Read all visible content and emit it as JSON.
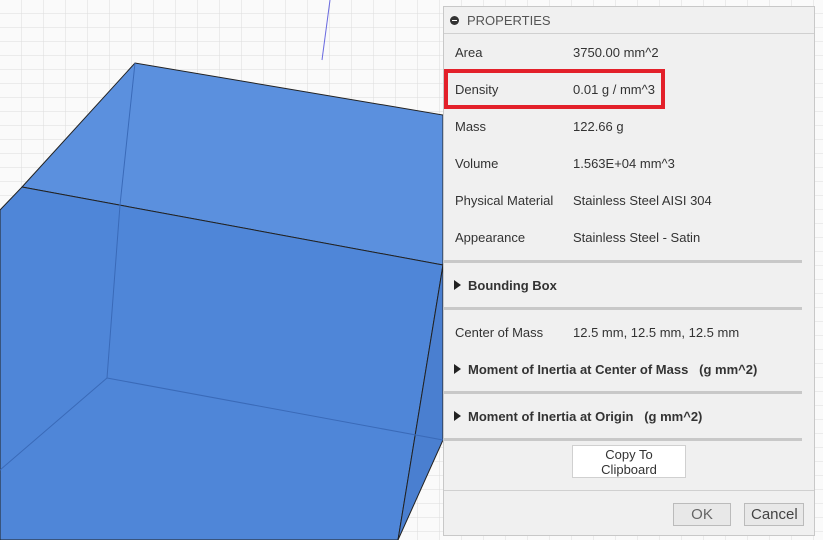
{
  "panel": {
    "title": "PROPERTIES",
    "rows": [
      {
        "label": "Area",
        "value": "3750.00 mm^2"
      },
      {
        "label": "Density",
        "value": "0.01 g / mm^3"
      },
      {
        "label": "Mass",
        "value": "122.66 g"
      },
      {
        "label": "Volume",
        "value": "1.563E+04 mm^3"
      },
      {
        "label": "Physical Material",
        "value": "Stainless Steel AISI 304"
      },
      {
        "label": "Appearance",
        "value": "Stainless Steel - Satin"
      }
    ],
    "bounding_box": "Bounding Box",
    "center_of_mass": {
      "label": "Center of Mass",
      "value": "12.5 mm, 12.5 mm, 12.5 mm"
    },
    "moi_center": "Moment of Inertia at Center of Mass   (g mm^2)",
    "moi_origin": "Moment of Inertia at Origin   (g mm^2)",
    "copy": "Copy To Clipboard",
    "ok": "OK",
    "cancel": "Cancel"
  },
  "colors": {
    "cube": "#5a8fdc",
    "highlight": "#e3202a"
  }
}
